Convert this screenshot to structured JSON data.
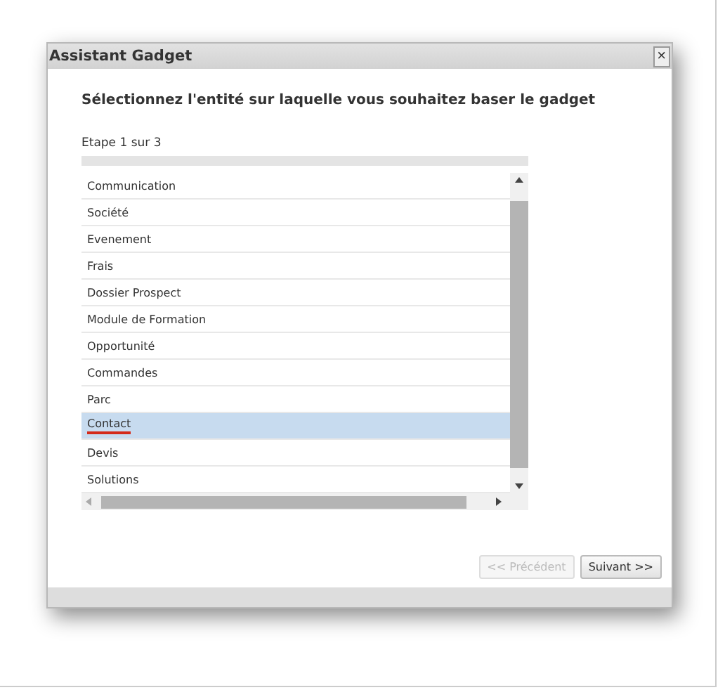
{
  "window": {
    "title": "Assistant Gadget",
    "close": "×"
  },
  "heading": "Sélectionnez l'entité sur laquelle vous souhaitez baser le gadget",
  "step": "Etape 1 sur 3",
  "list": {
    "items": [
      {
        "label": "Communication",
        "selected": false,
        "underlined": false
      },
      {
        "label": "Société",
        "selected": false,
        "underlined": false
      },
      {
        "label": "Evenement",
        "selected": false,
        "underlined": false
      },
      {
        "label": "Frais",
        "selected": false,
        "underlined": false
      },
      {
        "label": "Dossier Prospect",
        "selected": false,
        "underlined": false
      },
      {
        "label": "Module de Formation",
        "selected": false,
        "underlined": false
      },
      {
        "label": "Opportunité",
        "selected": false,
        "underlined": false
      },
      {
        "label": "Commandes",
        "selected": false,
        "underlined": false
      },
      {
        "label": "Parc",
        "selected": false,
        "underlined": false
      },
      {
        "label": "Contact",
        "selected": true,
        "underlined": true
      },
      {
        "label": "Devis",
        "selected": false,
        "underlined": false
      },
      {
        "label": "Solutions",
        "selected": false,
        "underlined": false
      }
    ]
  },
  "buttons": [
    {
      "label": "<< Précédent",
      "disabled": true
    },
    {
      "label": "Suivant >>",
      "disabled": false
    }
  ]
}
